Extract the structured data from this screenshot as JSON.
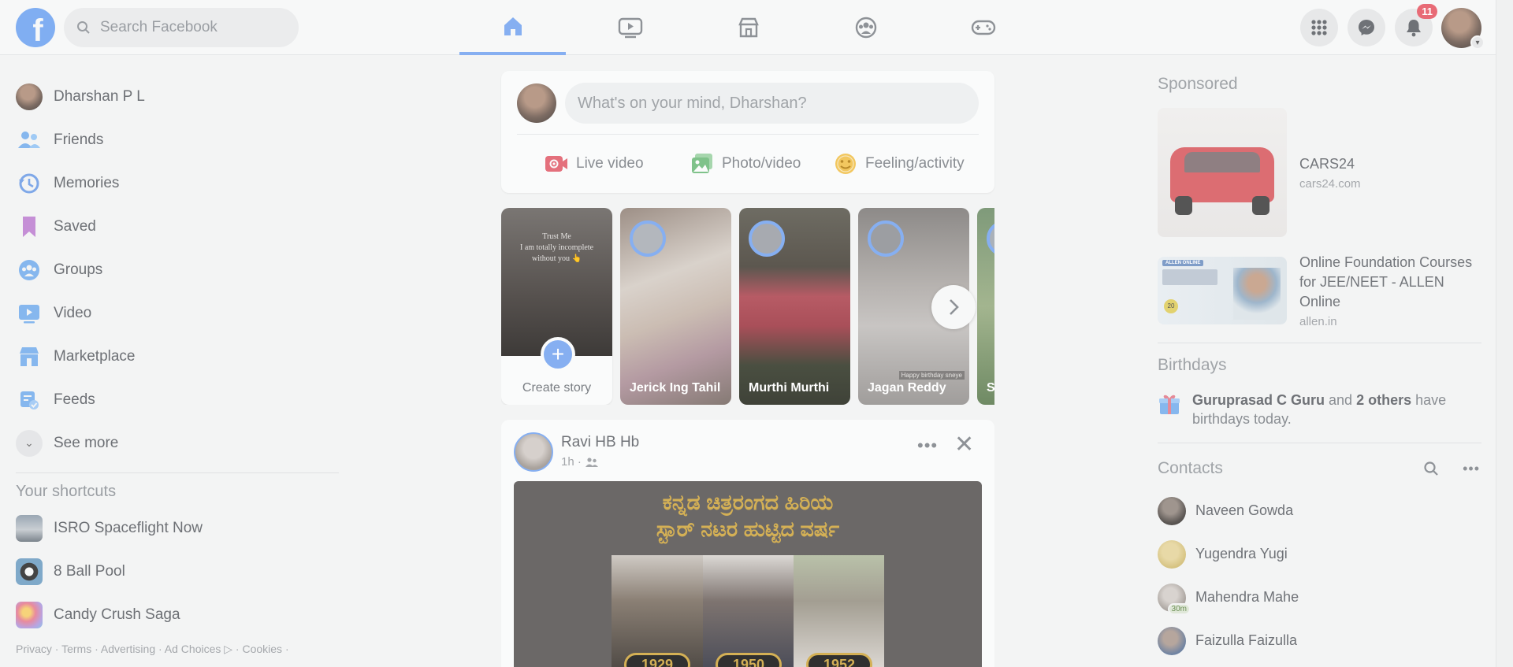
{
  "topbar": {
    "logo_letter": "f",
    "search_placeholder": "Search Facebook",
    "nav_tabs": [
      "home",
      "watch",
      "marketplace",
      "groups",
      "gaming"
    ],
    "notifications_count": "11"
  },
  "sidebar": {
    "profile_name": "Dharshan P L",
    "items": [
      {
        "label": "Friends",
        "icon": "friends-icon"
      },
      {
        "label": "Memories",
        "icon": "memories-icon"
      },
      {
        "label": "Saved",
        "icon": "saved-icon"
      },
      {
        "label": "Groups",
        "icon": "groups-icon"
      },
      {
        "label": "Video",
        "icon": "video-icon"
      },
      {
        "label": "Marketplace",
        "icon": "marketplace-icon"
      },
      {
        "label": "Feeds",
        "icon": "feeds-icon"
      }
    ],
    "see_more": "See more",
    "shortcuts_title": "Your shortcuts",
    "shortcuts": [
      {
        "label": "ISRO Spaceflight Now"
      },
      {
        "label": "8 Ball Pool"
      },
      {
        "label": "Candy Crush Saga"
      }
    ],
    "footer": "Privacy · Terms · Advertising · Ad Choices ▷ · Cookies ·"
  },
  "composer": {
    "placeholder": "What's on your mind, Dharshan?",
    "actions": [
      {
        "label": "Live video",
        "color": "#e4707c"
      },
      {
        "label": "Photo/video",
        "color": "#7fc28a"
      },
      {
        "label": "Feeling/activity",
        "color": "#f2c75f"
      }
    ]
  },
  "stories": {
    "create_label": "Create story",
    "create_overlay_text": "Trust Me\nI am totally incomplete\nwithout you 👆",
    "items": [
      {
        "name": "Jerick Ing Tahil"
      },
      {
        "name": "Murthi Murthi"
      },
      {
        "name": "Jagan Reddy",
        "overlay": "Happy birthday sneye"
      },
      {
        "name": "S"
      }
    ]
  },
  "post": {
    "author": "Ravi HB Hb",
    "time": "1h ·",
    "headline_line1": "ಕನ್ನಡ ಚಿತ್ರರಂಗದ ಹಿರಿಯ",
    "headline_line2": "ಸ್ಟಾರ್ ನಟರ ಹುಟ್ಟಿದ ವರ್ಷ",
    "years": [
      "1929",
      "1950",
      "1952"
    ]
  },
  "right": {
    "sponsored_title": "Sponsored",
    "ads": [
      {
        "name": "CARS24",
        "url": "cars24.com"
      },
      {
        "name": "Online Foundation Courses for JEE/NEET - ALLEN Online",
        "url": "allen.in",
        "thumb_header": "ALLEN ONLINE",
        "thumb_badge": "20"
      }
    ],
    "birthdays_title": "Birthdays",
    "birthday_name": "Guruprasad C Guru",
    "birthday_and": " and ",
    "birthday_others": "2 others",
    "birthday_suffix": " have birthdays today.",
    "contacts_title": "Contacts",
    "contacts": [
      {
        "name": "Naveen Gowda"
      },
      {
        "name": "Yugendra Yugi"
      },
      {
        "name": "Mahendra Mahe",
        "status": "30m"
      },
      {
        "name": "Faizulla Faizulla"
      }
    ]
  }
}
